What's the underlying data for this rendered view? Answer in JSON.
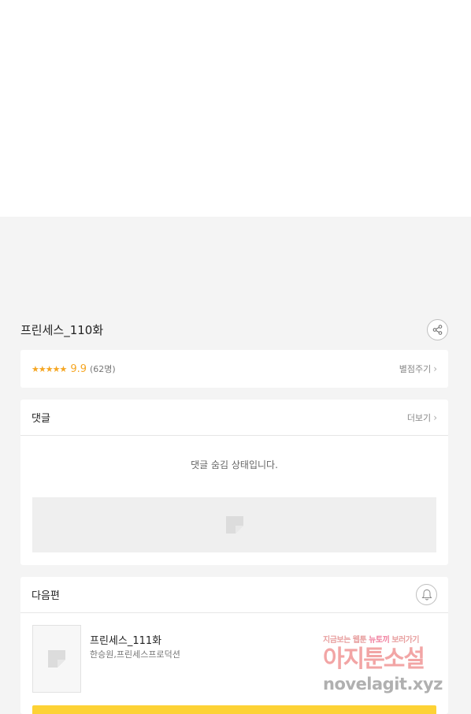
{
  "episode": {
    "title": "프린세스_110화"
  },
  "rating": {
    "stars": "★★★★★",
    "score": "9.9",
    "count": "(62명)",
    "rate_link": "별점주기"
  },
  "comments": {
    "heading": "댓글",
    "more_link": "더보기",
    "hidden_message": "댓글 숨김 상태입니다."
  },
  "next": {
    "heading": "다음편",
    "title": "프린세스_111화",
    "author": "한승원,프린세스프로덕션"
  },
  "watermark": {
    "line1_a": "지금보는 웹툰",
    "line1_b": "뉴토끼",
    "line1_c": "보러가기",
    "line2": "아지툰소설",
    "line3": "novelagit.xyz"
  },
  "icons": {
    "share": "share-icon",
    "bell": "bell-icon",
    "chevron": "chevron-right-icon",
    "placeholder": "image-placeholder-icon"
  },
  "colors": {
    "accent_star": "#f5a623",
    "button_yellow": "#fdd235",
    "background_gray": "#f4f4f4"
  }
}
